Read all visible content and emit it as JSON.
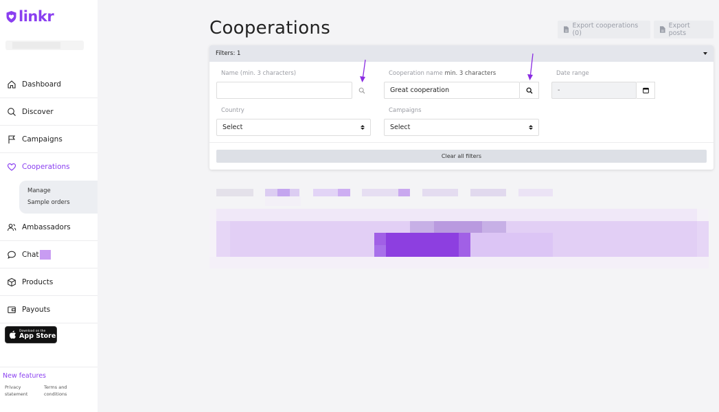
{
  "app": {
    "name": "linkr",
    "brand_color": "#8a3ff0"
  },
  "sidebar": {
    "items": [
      {
        "label": "Dashboard",
        "icon": "home-icon"
      },
      {
        "label": "Discover",
        "icon": "search-icon"
      },
      {
        "label": "Campaigns",
        "icon": "flag-icon"
      },
      {
        "label": "Cooperations",
        "icon": "heart-icon",
        "active": true
      },
      {
        "label": "Ambassadors",
        "icon": "users-icon"
      },
      {
        "label": "Chat",
        "icon": "chat-icon"
      },
      {
        "label": "Products",
        "icon": "box-icon"
      },
      {
        "label": "Payouts",
        "icon": "wallet-icon"
      }
    ],
    "submenu": [
      "Manage",
      "Sample orders"
    ],
    "appstore": {
      "line1": "Download on the",
      "line2": "App Store"
    },
    "footer": {
      "new_features": "New features",
      "privacy": [
        "Privacy",
        "statement"
      ],
      "terms": [
        "Terms and",
        "conditions"
      ]
    }
  },
  "header": {
    "title": "Cooperations",
    "export_cooperations": "Export cooperations (0)",
    "export_posts": "Export posts"
  },
  "filters": {
    "title": "Filters: 1",
    "name": {
      "label": "Name (min. 3 characters)",
      "value": ""
    },
    "coop_name": {
      "label_prefix": "Cooperation name",
      "label_hint": "min. 3 characters",
      "value": "Great cooperation"
    },
    "date_range": {
      "label": "Date range",
      "value": "-"
    },
    "country": {
      "label": "Country",
      "value": "Select"
    },
    "campaigns": {
      "label": "Campaigns",
      "value": "Select"
    },
    "clear_all": "Clear all filters"
  },
  "colors": {
    "accent": "#8a3ff0",
    "annotation_arrow": "#8a2be2"
  }
}
